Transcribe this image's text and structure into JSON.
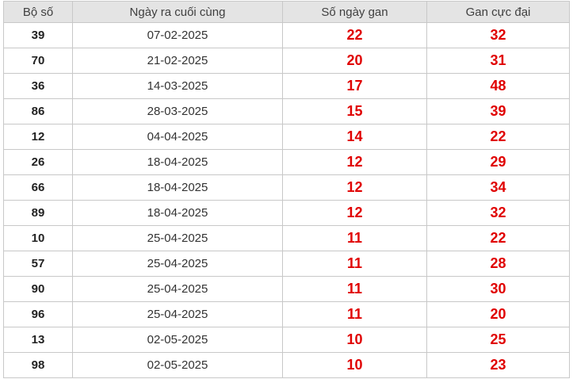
{
  "table": {
    "headers": [
      "Bộ số",
      "Ngày ra cuối cùng",
      "Số ngày gan",
      "Gan cực đại"
    ],
    "rows": [
      {
        "number": "39",
        "last_date": "07-02-2025",
        "gan_days": "22",
        "max_gan": "32"
      },
      {
        "number": "70",
        "last_date": "21-02-2025",
        "gan_days": "20",
        "max_gan": "31"
      },
      {
        "number": "36",
        "last_date": "14-03-2025",
        "gan_days": "17",
        "max_gan": "48"
      },
      {
        "number": "86",
        "last_date": "28-03-2025",
        "gan_days": "15",
        "max_gan": "39"
      },
      {
        "number": "12",
        "last_date": "04-04-2025",
        "gan_days": "14",
        "max_gan": "22"
      },
      {
        "number": "26",
        "last_date": "18-04-2025",
        "gan_days": "12",
        "max_gan": "29"
      },
      {
        "number": "66",
        "last_date": "18-04-2025",
        "gan_days": "12",
        "max_gan": "34"
      },
      {
        "number": "89",
        "last_date": "18-04-2025",
        "gan_days": "12",
        "max_gan": "32"
      },
      {
        "number": "10",
        "last_date": "25-04-2025",
        "gan_days": "11",
        "max_gan": "22"
      },
      {
        "number": "57",
        "last_date": "25-04-2025",
        "gan_days": "11",
        "max_gan": "28"
      },
      {
        "number": "90",
        "last_date": "25-04-2025",
        "gan_days": "11",
        "max_gan": "30"
      },
      {
        "number": "96",
        "last_date": "25-04-2025",
        "gan_days": "11",
        "max_gan": "20"
      },
      {
        "number": "13",
        "last_date": "02-05-2025",
        "gan_days": "10",
        "max_gan": "25"
      },
      {
        "number": "98",
        "last_date": "02-05-2025",
        "gan_days": "10",
        "max_gan": "23"
      }
    ]
  },
  "colors": {
    "header_bg": "#e4e4e4",
    "border": "#c8c8c8",
    "highlight_red": "#e00000"
  }
}
